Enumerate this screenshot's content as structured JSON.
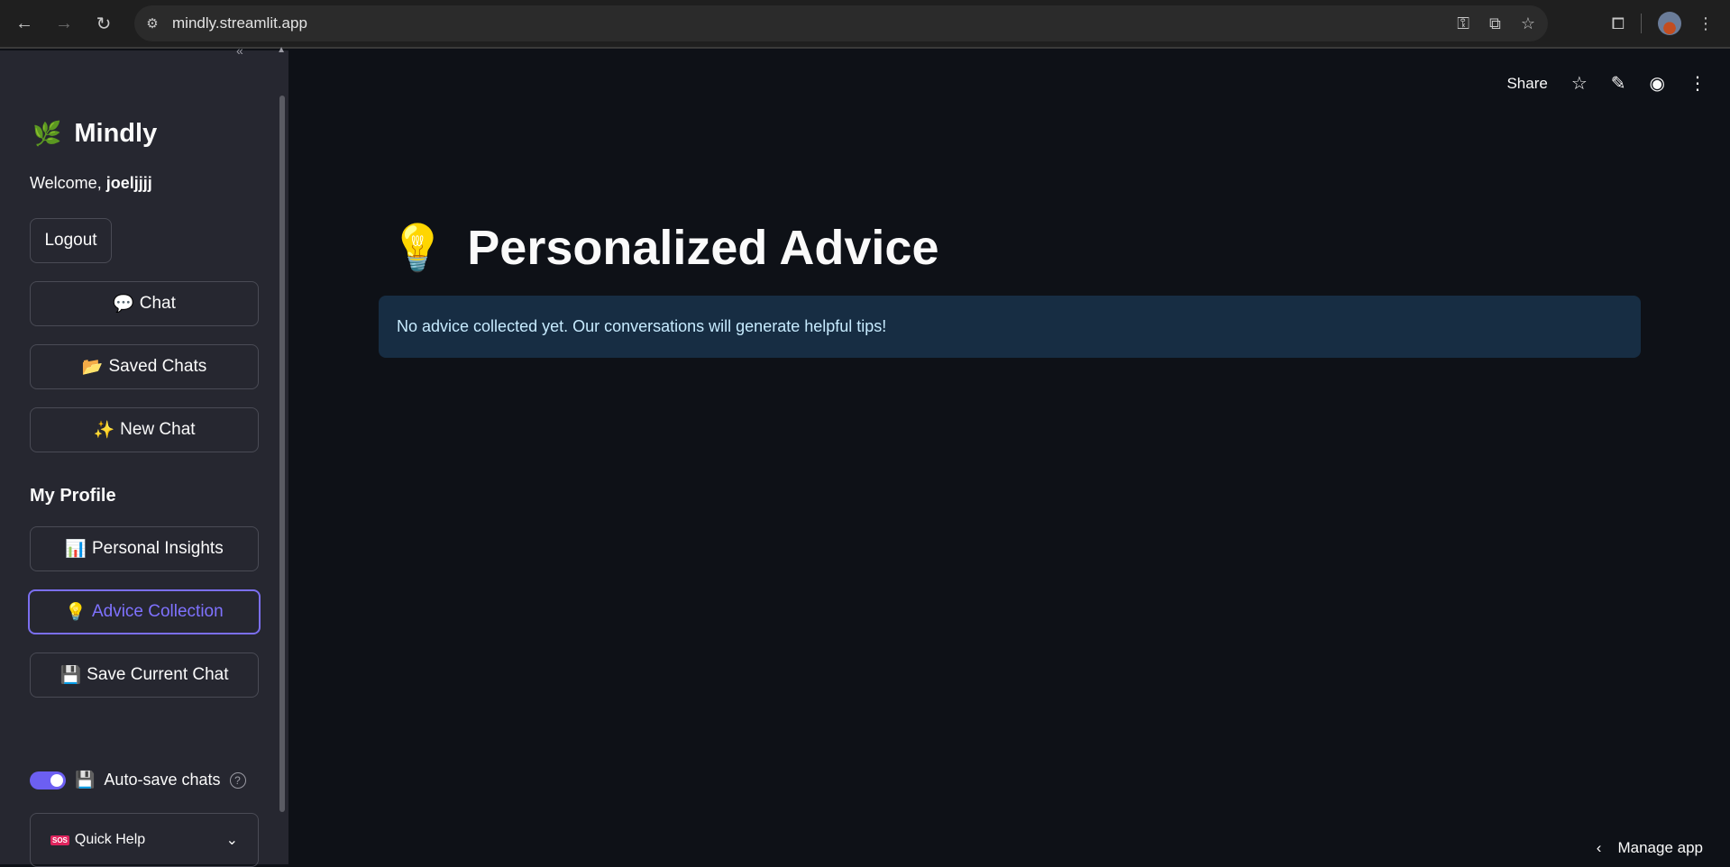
{
  "browser": {
    "url": "mindly.streamlit.app",
    "back_icon": "←",
    "forward_icon": "→",
    "reload_icon": "↻"
  },
  "sidebar": {
    "brand_icon": "🌿",
    "brand_name": "Mindly",
    "welcome_prefix": "Welcome,",
    "username": "joeljjjj",
    "logout_label": "Logout",
    "nav_buttons": [
      {
        "icon": "💬",
        "label": "Chat"
      },
      {
        "icon": "📂",
        "label": "Saved Chats"
      },
      {
        "icon": "✨",
        "label": "New Chat"
      }
    ],
    "section_title": "My Profile",
    "profile_buttons": [
      {
        "icon": "📊",
        "label": "Personal Insights"
      },
      {
        "icon": "💡",
        "label": "Advice Collection"
      },
      {
        "icon": "💾",
        "label": "Save Current Chat"
      }
    ],
    "autosave_icon": "💾",
    "autosave_label": "Auto-save chats",
    "autosave_on": true,
    "quick_help_badge": "SOS",
    "quick_help_label": "Quick Help"
  },
  "header": {
    "share_label": "Share"
  },
  "main": {
    "title_icon": "💡",
    "title": "Personalized Advice",
    "info_message": "No advice collected yet. Our conversations will generate helpful tips!"
  },
  "footer": {
    "manage_label": "Manage app"
  },
  "colors": {
    "accent": "#7f72ff",
    "info_bg": "#172d43",
    "sidebar_bg": "#262730",
    "main_bg": "#0e1117"
  }
}
